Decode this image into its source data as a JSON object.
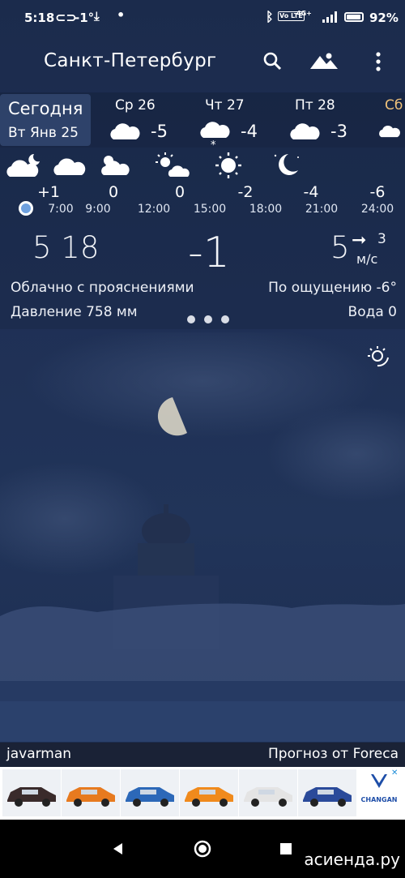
{
  "status_bar": {
    "time": "5:18",
    "temp": "-1°",
    "battery_percent": "92%",
    "battery_level": 0.92,
    "network": "4G+",
    "volte": "Vo LTE"
  },
  "header": {
    "city": "Санкт-Петербург",
    "icons": [
      "search-icon",
      "landscape-icon",
      "more-vert-icon"
    ]
  },
  "days": {
    "today": {
      "title": "Сегодня",
      "date": "Вт Янв 25"
    },
    "items": [
      {
        "label": "Ср 26",
        "temp": "-5",
        "icon": "cloud-icon"
      },
      {
        "label": "Чт 27",
        "temp": "-4",
        "icon": "cloud-snow-icon"
      },
      {
        "label": "Пт 28",
        "temp": "-3",
        "icon": "cloud-icon"
      },
      {
        "label": "Сб",
        "temp": "",
        "icon": "cloud-icon"
      }
    ]
  },
  "hourly": [
    {
      "time": "7:00",
      "temp": "+1",
      "icon": "moon-cloud-icon"
    },
    {
      "time": "9:00",
      "temp": "0",
      "icon": "cloud-icon"
    },
    {
      "time": "12:00",
      "temp": "0",
      "icon": "sun-cloud-icon"
    },
    {
      "time": "15:00",
      "temp": "-2",
      "icon": "sun-cloud-icon"
    },
    {
      "time": "18:00",
      "temp": "-4",
      "icon": "sun-icon"
    },
    {
      "time": "21:00",
      "temp": "-6",
      "icon": "moon-icon"
    },
    {
      "time": "24:00",
      "temp": "",
      "icon": ""
    }
  ],
  "current": {
    "time": "5 18",
    "temperature": "-1",
    "wind_speed": "5",
    "wind_gust": "3",
    "wind_unit": "м/с",
    "condition": "Облачно с прояснениями",
    "feels_like": "По ощущению -6°",
    "pressure": "Давление 758 мм",
    "water": "Вода 0"
  },
  "credits": {
    "user": "javarman",
    "provider": "Прогноз от Foreca"
  },
  "ad": {
    "brand": "CHANGAN",
    "car_colors": [
      "#3a2b2b",
      "#e77a1f",
      "#2c68b8",
      "#f08a1c",
      "#e4e4e4",
      "#2a4a9a"
    ]
  },
  "watermark": "асиенда.ру"
}
